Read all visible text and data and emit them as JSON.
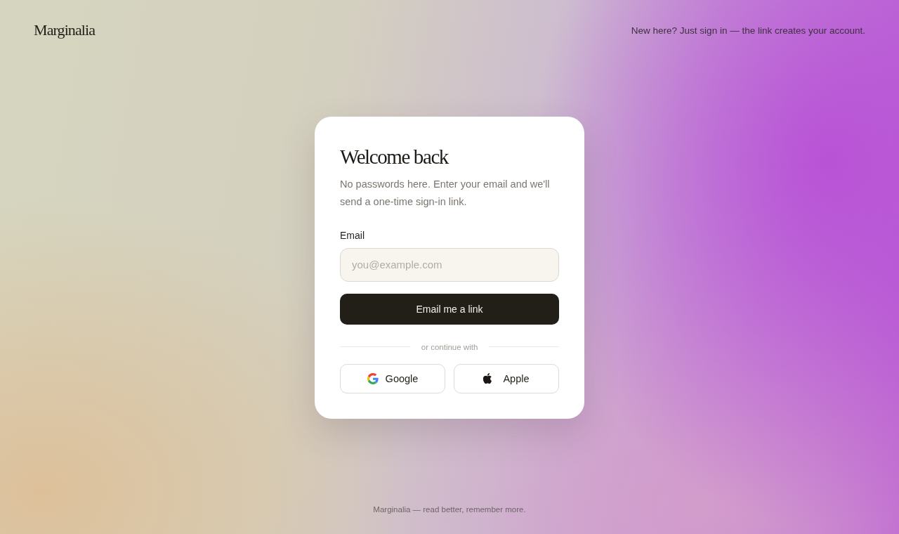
{
  "header": {
    "logo": "Marginalia",
    "note": "New here? Just sign in — the link creates your account."
  },
  "card": {
    "title": "Welcome back",
    "description": "No passwords here. Enter your email and we'll send a one-time sign-in link.",
    "email_field": {
      "label": "Email",
      "placeholder": "you@example.com"
    },
    "submit_button": "Email me a link",
    "divider": "or continue with",
    "providers": [
      {
        "kind": "google",
        "label": "Google"
      },
      {
        "kind": "apple",
        "label": "Apple"
      }
    ]
  },
  "footer": "Marginalia — read better, remember more."
}
